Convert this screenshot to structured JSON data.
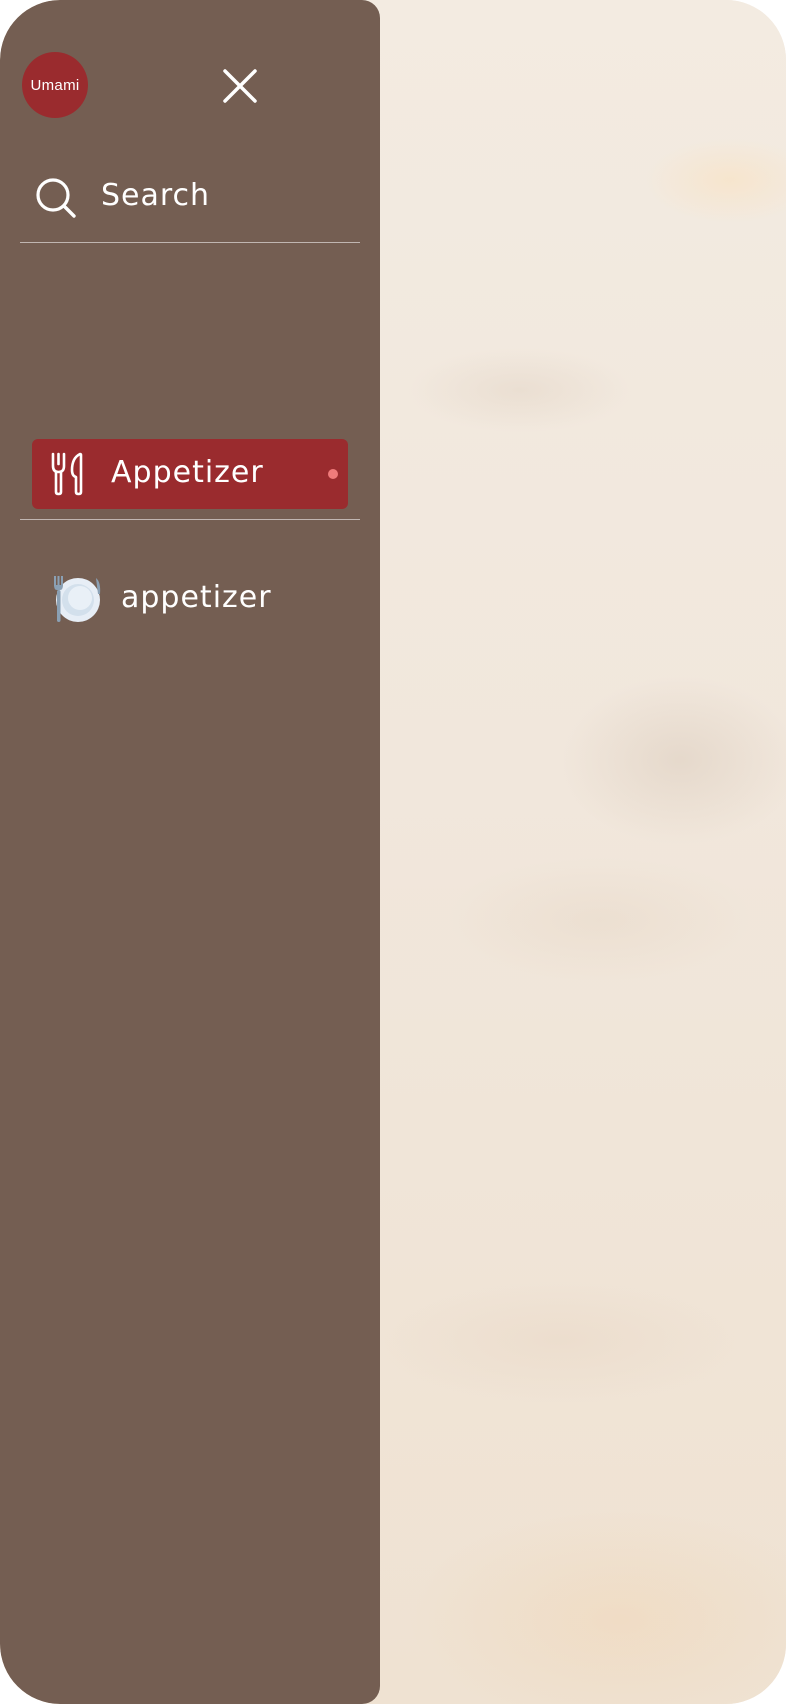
{
  "drawer": {
    "logo_text": "Umami",
    "search_label": "Search",
    "active_category": {
      "label": "Appetizer",
      "icon": "fork-knife-icon",
      "has_indicator": true
    },
    "items": [
      {
        "label": "appetizer",
        "icon": "plate-with-cutlery-icon"
      }
    ]
  },
  "colors": {
    "drawer_bg": "#745e52",
    "accent": "#9a2b2e",
    "indicator": "#f07b7b",
    "page_bg": "#f3ebe1"
  }
}
